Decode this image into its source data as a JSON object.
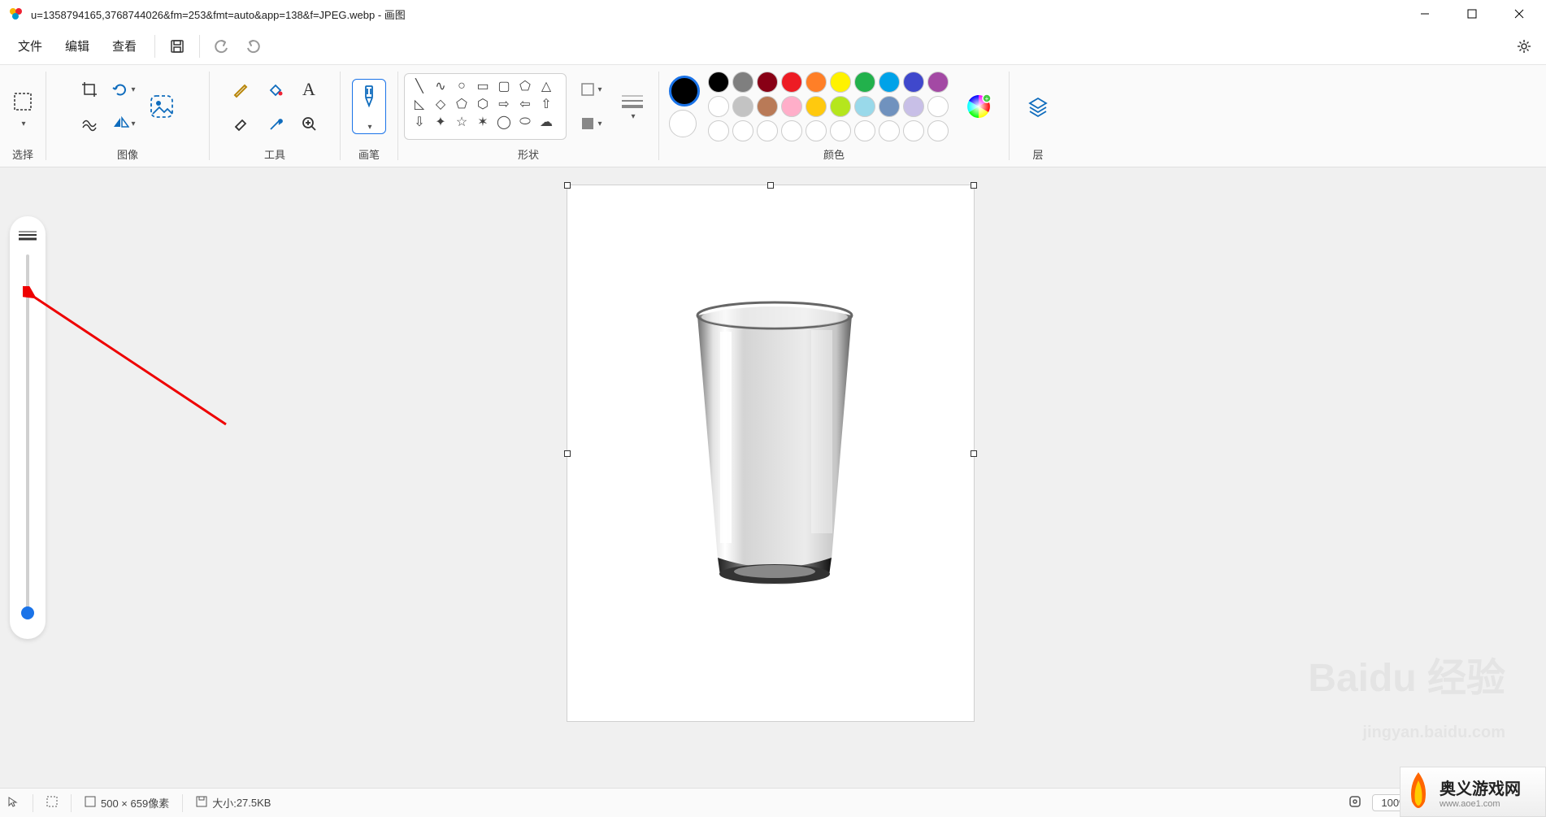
{
  "title": "u=1358794165,3768744026&fm=253&fmt=auto&app=138&f=JPEG.webp - 画图",
  "menu": {
    "file": "文件",
    "edit": "编辑",
    "view": "查看"
  },
  "ribbon": {
    "select": "选择",
    "image": "图像",
    "tools": "工具",
    "brush": "画笔",
    "shapes": "形状",
    "colors": "颜色",
    "layers": "层"
  },
  "colors": {
    "row1": [
      "#000000",
      "#7f7f7f",
      "#880015",
      "#ed1c24",
      "#ff7f27",
      "#fff200",
      "#22b14c",
      "#00a2e8",
      "#3f48cc",
      "#a349a4"
    ],
    "row2": [
      "#ffffff",
      "#c3c3c3",
      "#b97a57",
      "#ffaec9",
      "#ffc90e",
      "#b5e61d",
      "#99d9ea",
      "#7092be",
      "#c8bfe7",
      "#ffffff"
    ],
    "row3": [
      "#ffffff",
      "#ffffff",
      "#ffffff",
      "#ffffff",
      "#ffffff",
      "#ffffff",
      "#ffffff",
      "#ffffff",
      "#ffffff",
      "#ffffff"
    ],
    "primary": "#000000",
    "secondary": "#ffffff"
  },
  "status": {
    "dimensions": "500 × 659像素",
    "size_label": "大小: ",
    "size_value": "27.5KB",
    "zoom": "100%"
  },
  "watermark": {
    "brand": "Baidu",
    "sub": "经验",
    "url": "jingyan.baidu.com"
  },
  "sitelogo": {
    "text": "奥义游戏网",
    "url": "www.aoe1.com"
  }
}
